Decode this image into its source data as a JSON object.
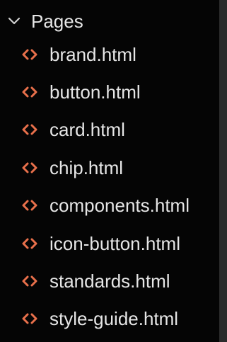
{
  "explorer": {
    "folder": {
      "label": "Pages",
      "expanded": true,
      "icon": "chevron-down-icon"
    },
    "files": [
      {
        "label": "brand.html",
        "icon": "html-file-icon"
      },
      {
        "label": "button.html",
        "icon": "html-file-icon"
      },
      {
        "label": "card.html",
        "icon": "html-file-icon"
      },
      {
        "label": "chip.html",
        "icon": "html-file-icon"
      },
      {
        "label": "components.html",
        "icon": "html-file-icon"
      },
      {
        "label": "icon-button.html",
        "icon": "html-file-icon"
      },
      {
        "label": "standards.html",
        "icon": "html-file-icon"
      },
      {
        "label": "style-guide.html",
        "icon": "html-file-icon"
      }
    ]
  },
  "colors": {
    "background": "#050505",
    "text": "#e6e6e6",
    "html_icon": "#e8704b",
    "chevron": "#d0d0d0",
    "side_strip": "#2b2b2b"
  }
}
